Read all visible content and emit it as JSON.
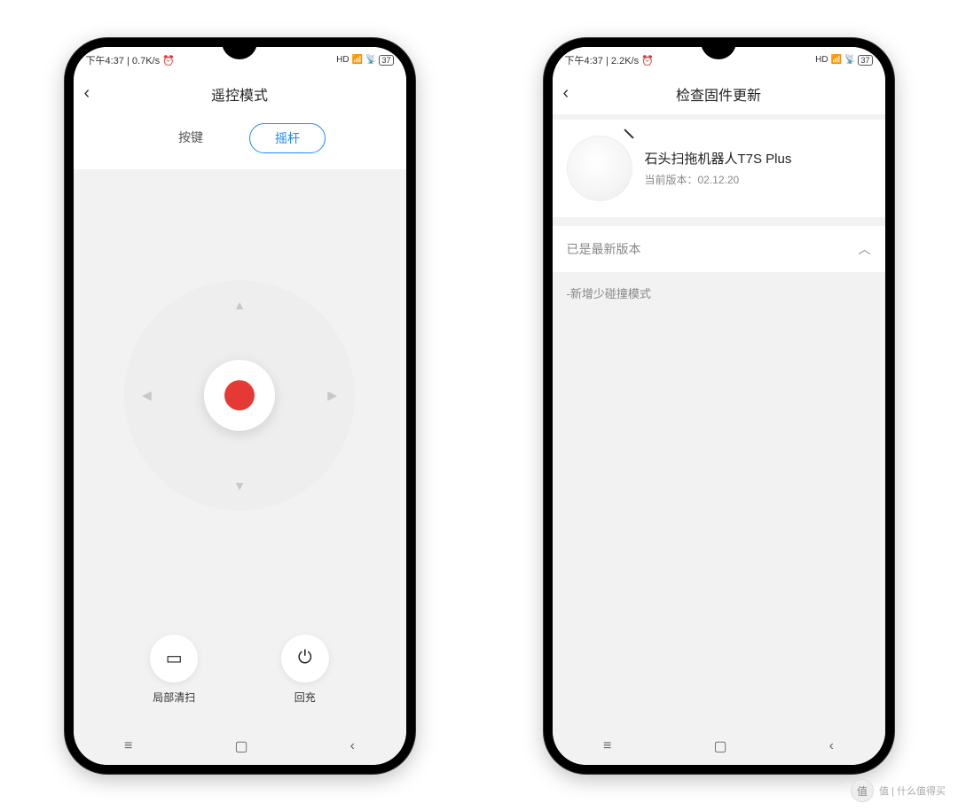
{
  "statusbar": {
    "time": "下午4:37",
    "speed_left": "0.7K/s",
    "speed_right": "2.2K/s",
    "alarm_icon": "⏰",
    "battery": "37"
  },
  "left": {
    "title": "遥控模式",
    "tabs": {
      "button": "按键",
      "joystick": "摇杆"
    },
    "actions": {
      "spot": "局部清扫",
      "dock": "回充"
    }
  },
  "right": {
    "title": "检查固件更新",
    "device": {
      "name": "石头扫拖机器人T7S Plus",
      "version_label": "当前版本：02.12.20"
    },
    "latest_label": "已是最新版本",
    "changelog_item": "-新增少碰撞模式"
  },
  "watermark": "值 | 什么值得买"
}
